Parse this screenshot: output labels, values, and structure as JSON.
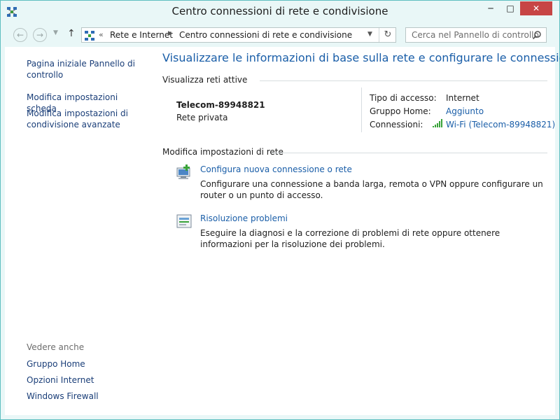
{
  "window": {
    "title": "Centro connessioni di rete e condivisione",
    "controls": {
      "minimize": "─",
      "maximize": "□",
      "close": "✕"
    }
  },
  "navigation": {
    "back": "←",
    "forward": "→",
    "up": "↑",
    "crumb_prefix": "«",
    "breadcrumb": [
      "Rete e Internet",
      "Centro connessioni di rete e condivisione"
    ],
    "refresh": "↻"
  },
  "search": {
    "placeholder": "Cerca nel Pannello di controllo"
  },
  "sidebar": {
    "items": [
      "Pagina iniziale Pannello di controllo",
      "Modifica impostazioni scheda",
      "Modifica impostazioni di condivisione avanzate"
    ],
    "see_also_heading": "Vedere anche",
    "see_also": [
      "Gruppo Home",
      "Opzioni Internet",
      "Windows Firewall"
    ]
  },
  "main": {
    "title": "Visualizzare le informazioni di base sulla rete e configurare le connessioni",
    "active_networks_heading": "Visualizza reti attive",
    "network": {
      "name": "Telecom-89948821",
      "category": "Rete privata",
      "access_type_label": "Tipo di accesso:",
      "access_type_value": "Internet",
      "homegroup_label": "Gruppo Home:",
      "homegroup_value": "Aggiunto",
      "connections_label": "Connessioni:",
      "connections_value": "Wi-Fi (Telecom-89948821)"
    },
    "change_settings_heading": "Modifica impostazioni di rete",
    "tasks": [
      {
        "title": "Configura nuova connessione o rete",
        "description": "Configurare una connessione a banda larga, remota o VPN oppure configurare un router o un punto di accesso."
      },
      {
        "title": "Risoluzione problemi",
        "description": "Eseguire la diagnosi e la correzione di problemi di rete oppure ottenere informazioni per la risoluzione dei problemi."
      }
    ]
  },
  "colors": {
    "frame": "#e9f7f7",
    "link": "#1a5ea8",
    "close_button": "#c74545"
  },
  "icons": {
    "title": "network-center-icon",
    "search": "search-icon",
    "wifi": "wifi-signal-icon"
  }
}
